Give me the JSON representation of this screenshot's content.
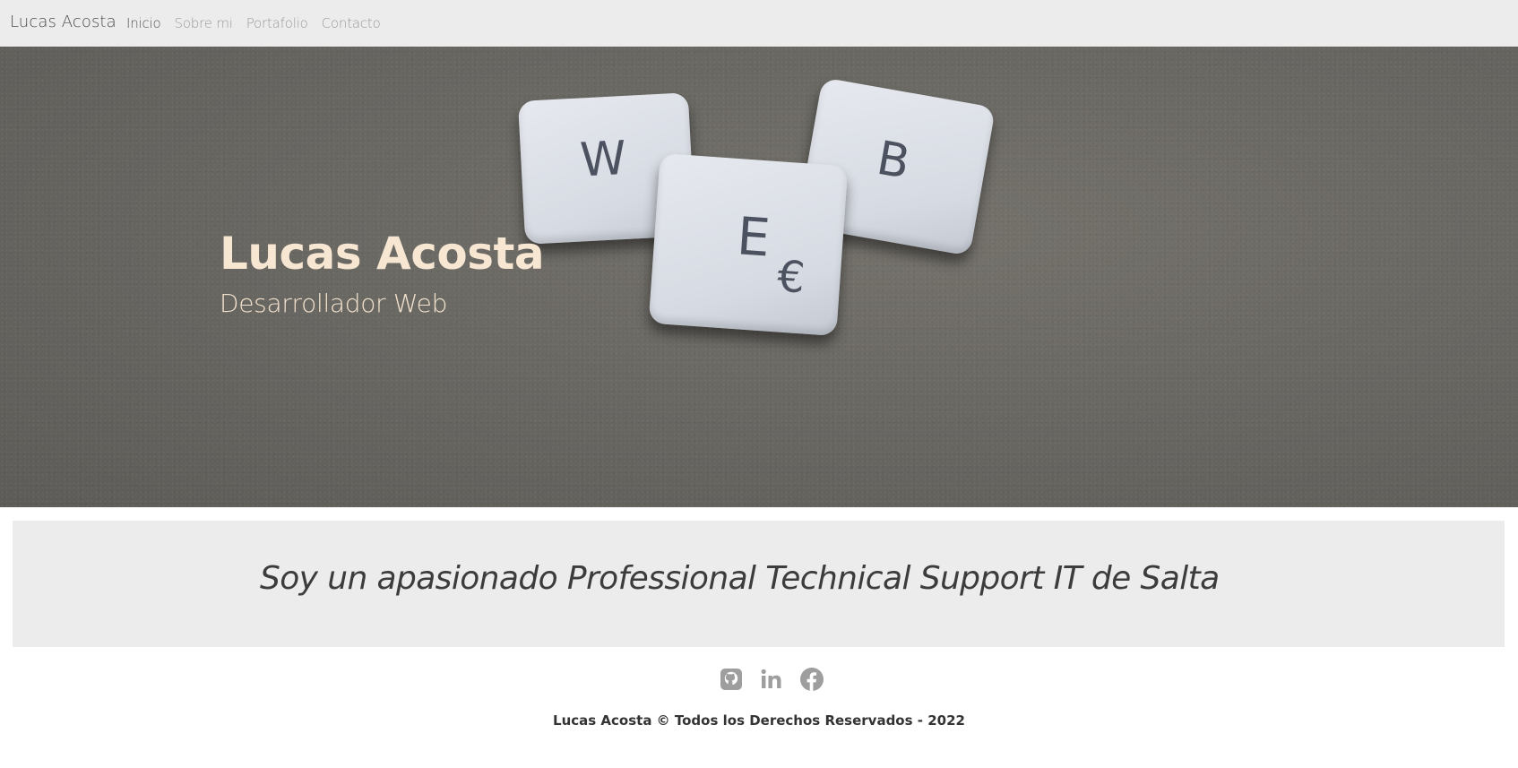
{
  "navbar": {
    "brand": "Lucas Acosta",
    "links": [
      {
        "label": "Inicio",
        "active": true
      },
      {
        "label": "Sobre mi",
        "active": false
      },
      {
        "label": "Portafolio",
        "active": false
      },
      {
        "label": "Contacto",
        "active": false
      }
    ]
  },
  "hero": {
    "title": "Lucas Acosta",
    "subtitle": "Desarrollador Web",
    "tiles": {
      "w": "W",
      "e": "E",
      "euro": "€",
      "b": "B"
    }
  },
  "about": {
    "text": "Soy un apasionado Professional Technical Support IT de Salta"
  },
  "footer": {
    "social_icons": [
      "github-icon",
      "linkedin-icon",
      "facebook-icon"
    ],
    "copyright": "Lucas Acosta © Todos los Derechos Reservados - 2022"
  },
  "colors": {
    "navbar_bg": "#ececec",
    "hero_title": "#f6e6d2",
    "about_bg": "#ececec",
    "icon_gray": "#9e9e9e"
  }
}
